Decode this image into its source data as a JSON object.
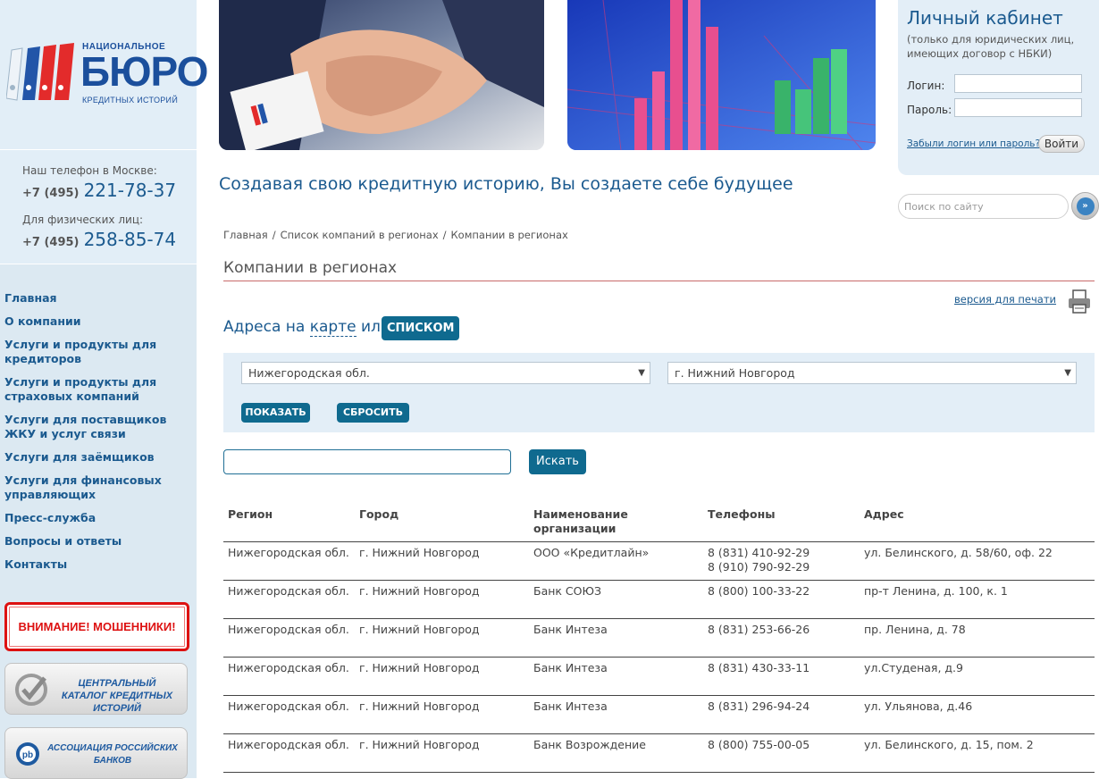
{
  "logo": {
    "top_text": "НАЦИОНАЛЬНОЕ",
    "main_text": "БЮРО",
    "bottom_text": "КРЕДИТНЫХ ИСТОРИЙ"
  },
  "contacts": {
    "moscow_label": "Наш телефон в Москве:",
    "moscow_code": "+7 (495)",
    "moscow_number": "221-78-37",
    "individuals_label": "Для физических лиц:",
    "individuals_code": "+7 (495)",
    "individuals_number": "258-85-74"
  },
  "nav": [
    "Главная",
    "О компании",
    "Услуги и продукты для кредиторов",
    "Услуги и продукты для страховых компаний",
    "Услуги для поставщиков ЖКУ и услуг связи",
    "Услуги для заёмщиков",
    "Услуги для финансовых управляющих",
    "Пресс-служба",
    "Вопросы и ответы",
    "Контакты"
  ],
  "fraud_banner": "ВНИМАНИЕ! МОШЕННИКИ!",
  "banners": {
    "catalog": "ЦЕНТРАЛЬНЫЙ КАТАЛОГ КРЕДИТНЫХ ИСТОРИЙ",
    "association": "АССОЦИАЦИЯ РОССИЙСКИХ БАНКОВ"
  },
  "login": {
    "title": "Личный кабинет",
    "note": "(только для юридических лиц, имеющих договор с НБКИ)",
    "login_label": "Логин:",
    "password_label": "Пароль:",
    "forgot": "Забыли логин или пароль?",
    "submit": "Войти"
  },
  "site_search": {
    "placeholder": "Поиск по сайту"
  },
  "slogan": "Создавая свою кредитную историю, Вы создаете себе будущее",
  "breadcrumb": [
    "Главная",
    "Список компаний в регионах",
    "Компании в регионах"
  ],
  "page_title": "Компании в регионах",
  "print_link": "версия для печати",
  "address_heading": {
    "prefix": "Адреса на",
    "map": "карте",
    "or": "или",
    "list": "СПИСКОМ"
  },
  "filters": {
    "region": "Нижегородская обл.",
    "city": "г. Нижний Новгород",
    "show": "ПОКАЗАТЬ",
    "reset": "СБРОСИТЬ"
  },
  "search": {
    "value": "",
    "button": "Искать"
  },
  "table": {
    "headers": [
      "Регион",
      "Город",
      "Наименование организации",
      "Телефоны",
      "Адрес"
    ],
    "rows": [
      [
        "Нижегородская обл.",
        "г. Нижний Новгород",
        "ООО «Кредитлайн»",
        "8 (831) 410-92-29\n8 (910) 790-92-29",
        "ул. Белинского, д. 58/60, оф. 22"
      ],
      [
        "Нижегородская обл.",
        "г. Нижний Новгород",
        "Банк СОЮЗ",
        "8 (800) 100-33-22",
        "пр-т Ленина, д. 100, к. 1"
      ],
      [
        "Нижегородская обл.",
        "г. Нижний Новгород",
        "Банк Интеза",
        "8 (831) 253-66-26",
        "пр. Ленина, д. 78"
      ],
      [
        "Нижегородская обл.",
        "г. Нижний Новгород",
        "Банк Интеза",
        "8 (831) 430-33-11",
        "ул.Студеная, д.9"
      ],
      [
        "Нижегородская обл.",
        "г. Нижний Новгород",
        "Банк Интеза",
        "8 (831) 296-94-24",
        "ул. Ульянова, д.46"
      ],
      [
        "Нижегородская обл.",
        "г. Нижний Новгород",
        "Банк Возрождение",
        "8 (800) 755-00-05",
        "ул. Белинского, д. 15, пом. 2"
      ]
    ]
  },
  "colors": {
    "brand_blue": "#1b5a8f",
    "button": "#0f6a8f",
    "alert_red": "#dd1111",
    "panel": "#e3eef7"
  }
}
